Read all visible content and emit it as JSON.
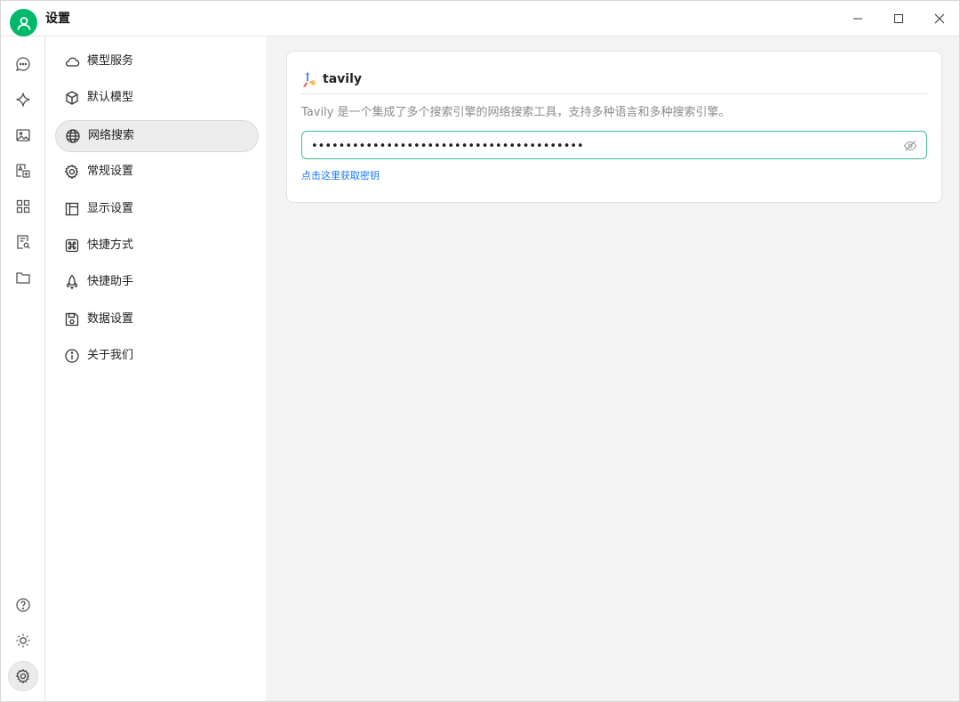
{
  "window": {
    "title": "设置"
  },
  "menu": {
    "items": [
      {
        "label": "模型服务",
        "icon": "cloud-icon"
      },
      {
        "label": "默认模型",
        "icon": "cube-icon"
      },
      {
        "label": "网络搜索",
        "icon": "globe-icon"
      },
      {
        "label": "常规设置",
        "icon": "gear-icon"
      },
      {
        "label": "显示设置",
        "icon": "layout-icon"
      },
      {
        "label": "快捷方式",
        "icon": "command-icon"
      },
      {
        "label": "快捷助手",
        "icon": "rocket-icon"
      },
      {
        "label": "数据设置",
        "icon": "save-icon"
      },
      {
        "label": "关于我们",
        "icon": "info-icon"
      }
    ],
    "active_index": 2
  },
  "rail": {
    "top_icons": [
      "chat-icon",
      "sparkle-icon",
      "image-icon",
      "translate-icon",
      "apps-icon",
      "knowledge-icon",
      "folder-icon"
    ],
    "bottom_icons": [
      "help-icon",
      "theme-sun-icon",
      "settings-icon"
    ]
  },
  "provider": {
    "name": "tavily",
    "description": "Tavily 是一个集成了多个搜索引擎的网络搜索工具，支持多种语言和多种搜索引擎。",
    "api_key_masked": "••••••••••••••••••••••••••••••••••••••••",
    "get_key_link": "点击这里获取密钥"
  },
  "colors": {
    "accent": "#00b96b",
    "link": "#1677ff",
    "input_border": "#3cc08a"
  }
}
